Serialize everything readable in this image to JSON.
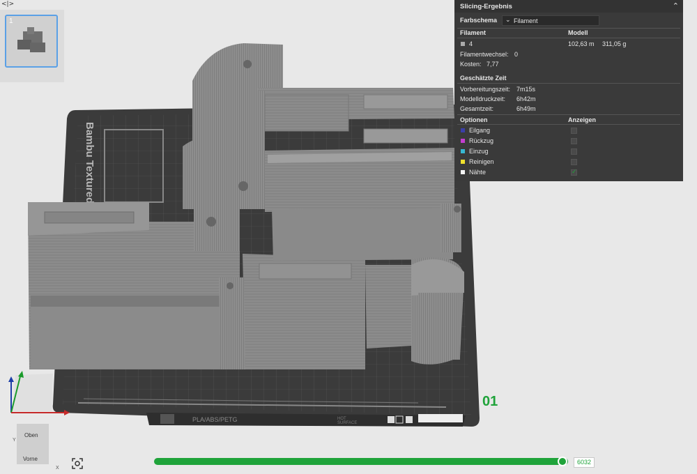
{
  "panel": {
    "title": "Slicing-Ergebnis",
    "farbschema_label": "Farbschema",
    "farbschema_value": "Filament",
    "filament_header": "Filament",
    "modell_header": "Modell",
    "filament_number": "4",
    "length": "102,63 m",
    "weight": "311,05 g",
    "filamentwechsel_label": "Filamentwechsel:",
    "filamentwechsel_value": "0",
    "kosten_label": "Kosten:",
    "kosten_value": "7,77",
    "time_header": "Geschätzte Zeit",
    "vorbereitung_label": "Vorbereitungszeit:",
    "vorbereitung_value": "7m15s",
    "modelldruck_label": "Modelldruckzeit:",
    "modelldruck_value": "6h42m",
    "gesamt_label": "Gesamtzeit:",
    "gesamt_value": "6h49m",
    "optionen_header": "Optionen",
    "anzeigen_header": "Anzeigen",
    "options": [
      {
        "label": "Eilgang",
        "color": "#3b3fa8",
        "checked": false
      },
      {
        "label": "Rückzug",
        "color": "#c43ed0",
        "checked": false
      },
      {
        "label": "Einzug",
        "color": "#38b8d2",
        "checked": false
      },
      {
        "label": "Reinigen",
        "color": "#f0e12e",
        "checked": false
      },
      {
        "label": "Nähte",
        "color": "#f4f4f4",
        "checked": true
      }
    ]
  },
  "thumbnail": {
    "number": "1"
  },
  "plate": {
    "brand_text": "Bambu Textured",
    "plate_number": "01",
    "material_text": "PLA/ABS/PETG",
    "hot_text": "HOT",
    "surface_text": "SURFACE"
  },
  "nav_cube": {
    "top": "Oben",
    "front": "Vorne"
  },
  "axis": {
    "y_label": "Y",
    "x_label": "X"
  },
  "layer_slider": {
    "value": "6032",
    "fraction": 1.0
  },
  "colors": {
    "accent": "#1fa33a",
    "panel_bg": "#3a3a3a",
    "plate": "#3d3d3d",
    "model": "#8a8a8a"
  },
  "icons": [
    "collapse-sidebar-icon",
    "chevron-up-icon",
    "chevron-down-icon",
    "fit-view-icon"
  ]
}
